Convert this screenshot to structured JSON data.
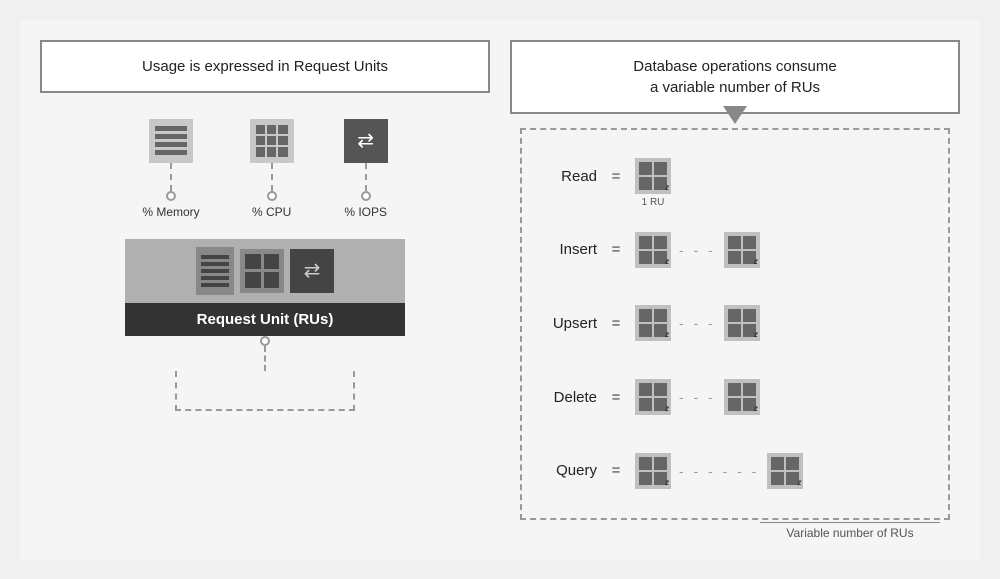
{
  "left": {
    "header": "Usage is expressed in Request Units",
    "icons": [
      {
        "type": "storage",
        "label": "% Memory"
      },
      {
        "type": "grid",
        "label": "% CPU"
      },
      {
        "type": "transfer",
        "label": "% IOPS"
      }
    ],
    "ru_label": "Request Unit (RUs)"
  },
  "right": {
    "header_line1": "Database operations consume",
    "header_line2": "a variable number of RUs",
    "operations": [
      {
        "name": "Read",
        "equals": "=",
        "count": 1,
        "has_dashes": false
      },
      {
        "name": "Insert",
        "equals": "=",
        "count": 2,
        "has_dashes": true
      },
      {
        "name": "Upsert",
        "equals": "=",
        "count": 2,
        "has_dashes": true
      },
      {
        "name": "Delete",
        "equals": "=",
        "count": 2,
        "has_dashes": true
      },
      {
        "name": "Query",
        "equals": "=",
        "count": 2,
        "has_dashes": true,
        "long_dashes": true
      }
    ],
    "ru_1_label": "1 RU",
    "variable_label": "Variable number of RUs"
  }
}
